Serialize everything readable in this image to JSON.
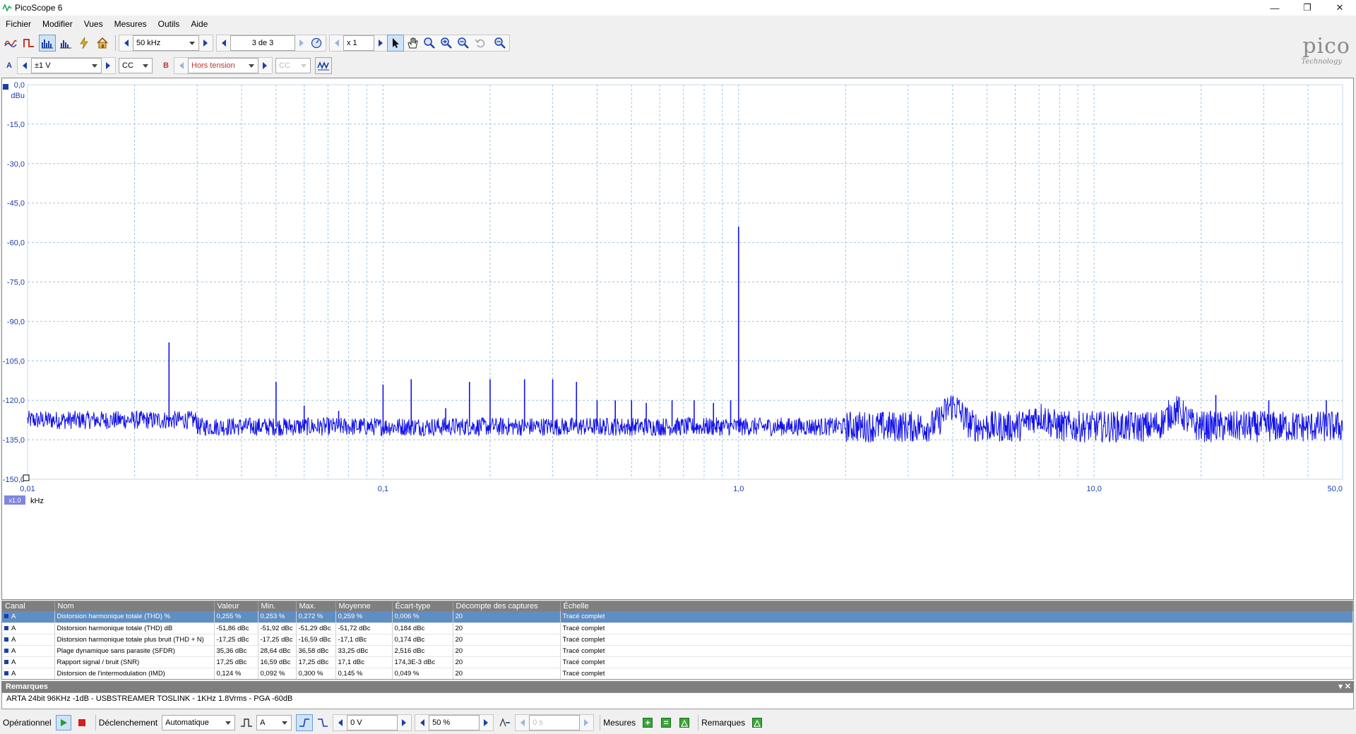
{
  "window": {
    "title": "PicoScope 6"
  },
  "menu": [
    "Fichier",
    "Modifier",
    "Vues",
    "Mesures",
    "Outils",
    "Aide"
  ],
  "toolbar1": {
    "timebase": "50 kHz",
    "capture_counter": "3 de 3",
    "zoom_factor": "x 1"
  },
  "toolbar2": {
    "channel_a_label": "A",
    "channel_a_range": "±1 V",
    "channel_a_coupling": "CC",
    "channel_b_label": "B",
    "channel_b_range": "Hors tension",
    "channel_b_coupling": "CC"
  },
  "logo": {
    "word": "pico",
    "sub": "Technology"
  },
  "colors": {
    "trace": "#1212e8",
    "grid": "#9ec4e0",
    "axis_text": "#1a3fa8",
    "header_bg": "#7f7f7f",
    "selected_row": "#5f8ec2"
  },
  "chart_data": {
    "type": "line",
    "y_unit_label": "dBu",
    "x_unit_label": "kHz",
    "x_scale_badge": "x1.0",
    "x_scale": "log",
    "xlim": [
      0.01,
      50.0
    ],
    "ylim": [
      -150,
      0
    ],
    "y_ticks": [
      "0,0",
      "-15,0",
      "-30,0",
      "-45,0",
      "-60,0",
      "-75,0",
      "-90,0",
      "-105,0",
      "-120,0",
      "-135,0",
      "-150,0"
    ],
    "x_ticks": [
      {
        "value": 0.01,
        "label": "0,01"
      },
      {
        "value": 0.1,
        "label": "0,1"
      },
      {
        "value": 1.0,
        "label": "1,0"
      },
      {
        "value": 10.0,
        "label": "10,0"
      },
      {
        "value": 50.0,
        "label": "50,0"
      }
    ],
    "noise_floor_dbu": -130,
    "peaks": [
      {
        "x": 0.025,
        "y": -98
      },
      {
        "x": 0.05,
        "y": -113
      },
      {
        "x": 0.06,
        "y": -122
      },
      {
        "x": 0.075,
        "y": -124
      },
      {
        "x": 0.1,
        "y": -114
      },
      {
        "x": 0.12,
        "y": -112
      },
      {
        "x": 0.15,
        "y": -123
      },
      {
        "x": 0.175,
        "y": -113
      },
      {
        "x": 0.2,
        "y": -112
      },
      {
        "x": 0.25,
        "y": -112
      },
      {
        "x": 0.3,
        "y": -112
      },
      {
        "x": 0.35,
        "y": -113
      },
      {
        "x": 0.4,
        "y": -120
      },
      {
        "x": 0.45,
        "y": -120
      },
      {
        "x": 0.5,
        "y": -120
      },
      {
        "x": 0.55,
        "y": -121
      },
      {
        "x": 0.65,
        "y": -120
      },
      {
        "x": 0.75,
        "y": -120
      },
      {
        "x": 0.85,
        "y": -121
      },
      {
        "x": 0.95,
        "y": -120
      },
      {
        "x": 1.0,
        "y": -54
      },
      {
        "x": 22.0,
        "y": -118
      },
      {
        "x": 31.0,
        "y": -120
      },
      {
        "x": 45.0,
        "y": -120
      }
    ],
    "humps": [
      {
        "x": 4.0,
        "y": -122
      },
      {
        "x": 7.0,
        "y": -126
      },
      {
        "x": 17.0,
        "y": -124
      }
    ]
  },
  "measurements": {
    "headers": [
      "Canal",
      "Nom",
      "Valeur",
      "Min.",
      "Max.",
      "Moyenne",
      "Écart-type",
      "Décompte des captures",
      "Échelle"
    ],
    "rows": [
      [
        "A",
        "Distorsion harmonique totale (THD) %",
        "0,255 %",
        "0,253 %",
        "0,272 %",
        "0,259 %",
        "0,006 %",
        "20",
        "Tracé complet"
      ],
      [
        "A",
        "Distorsion harmonique totale (THD) dB",
        "-51,86 dBc",
        "-51,92 dBc",
        "-51,29 dBc",
        "-51,72 dBc",
        "0,184 dBc",
        "20",
        "Tracé complet"
      ],
      [
        "A",
        "Distorsion harmonique totale plus bruit (THD + N)",
        "-17,25 dBc",
        "-17,25 dBc",
        "-16,59 dBc",
        "-17,1 dBc",
        "0,174 dBc",
        "20",
        "Tracé complet"
      ],
      [
        "A",
        "Plage dynamique sans parasite (SFDR)",
        "35,36 dBc",
        "28,64 dBc",
        "36,58 dBc",
        "33,25 dBc",
        "2,516 dBc",
        "20",
        "Tracé complet"
      ],
      [
        "A",
        "Rapport signal / bruit (SNR)",
        "17,25 dBc",
        "16,59 dBc",
        "17,25 dBc",
        "17,1 dBc",
        "174,3E-3 dBc",
        "20",
        "Tracé complet"
      ],
      [
        "A",
        "Distorsion de l'intermodulation (IMD)",
        "0,124 %",
        "0,092 %",
        "0,300 %",
        "0,145 %",
        "0,049 %",
        "20",
        "Tracé complet"
      ]
    ]
  },
  "notes": {
    "title": "Remarques",
    "text": "ARTA 24bit 96KHz -1dB - USBSTREAMER TOSLINK - 1KHz 1.8Vrms - PGA -60dB"
  },
  "statusbar": {
    "running_label": "Opérationnel",
    "trigger_label": "Déclenchement",
    "trigger_mode": "Automatique",
    "trigger_channel": "A",
    "trigger_level": "0 V",
    "pretrigger": "50 %",
    "delay": "0 s",
    "measurements_label": "Mesures",
    "notes_label": "Remarques"
  }
}
